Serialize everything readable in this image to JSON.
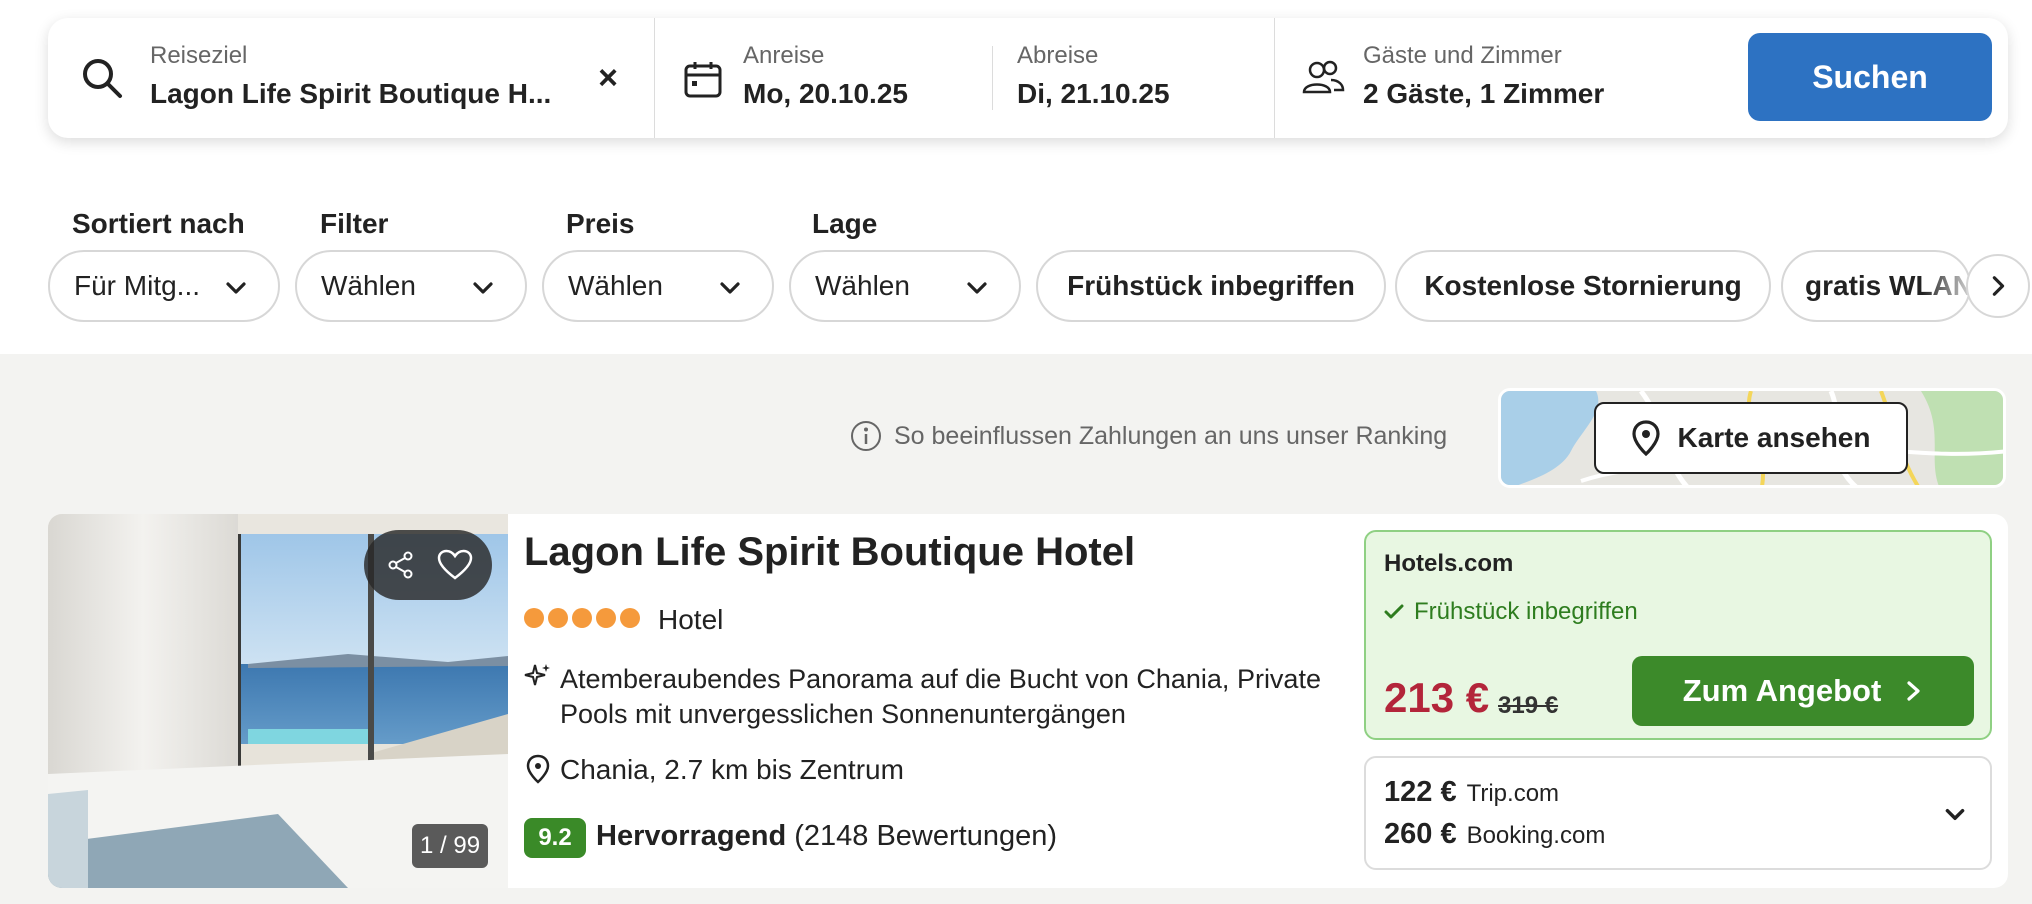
{
  "search": {
    "destination_label": "Reiseziel",
    "destination_value": "Lagon Life Spirit Boutique H...",
    "clear_icon": "×",
    "checkin_label": "Anreise",
    "checkin_value": "Mo, 20.10.25",
    "checkout_label": "Abreise",
    "checkout_value": "Di, 21.10.25",
    "guests_label": "Gäste und Zimmer",
    "guests_value": "2 Gäste, 1 Zimmer",
    "search_button": "Suchen",
    "icons": [
      "search-icon",
      "clear-icon",
      "calendar-icon",
      "guests-icon"
    ]
  },
  "filters": {
    "sort": {
      "label": "Sortiert nach",
      "value": "Für Mitg..."
    },
    "filter": {
      "label": "Filter",
      "value": "Wählen"
    },
    "price": {
      "label": "Preis",
      "value": "Wählen"
    },
    "location": {
      "label": "Lage",
      "value": "Wählen"
    },
    "tags": [
      "Frühstück inbegriffen",
      "Kostenlose Stornierung",
      "gratis WLAN"
    ]
  },
  "info": {
    "ranking_note": "So beeinflussen Zahlungen an uns unser Ranking",
    "map_button": "Karte ansehen"
  },
  "result": {
    "image_counter": "1 / 99",
    "name": "Lagon Life Spirit Boutique Hotel",
    "star_count": 5,
    "type": "Hotel",
    "highlight": "Atemberaubendes Panorama auf die Bucht von Chania, Private Pools mit unvergesslichen Sonnenuntergängen",
    "location": "Chania, 2.7 km bis Zentrum",
    "rating_score": "9.2",
    "rating_word": "Hervorragend",
    "rating_count": "(2148 Bewertungen)",
    "deal": {
      "provider": "Hotels.com",
      "perk": "Frühstück inbegriffen",
      "price": "213 €",
      "old_price": "319 €",
      "button": "Zum Angebot"
    },
    "other_offers": [
      {
        "price": "122 €",
        "site": "Trip.com"
      },
      {
        "price": "260 €",
        "site": "Booking.com"
      }
    ]
  },
  "colors": {
    "search_button": "#2d72c2",
    "deal_button": "#3c8a2a",
    "deal_price": "#b3253a",
    "deal_bg": "#e8f7e2",
    "rating_badge": "#3a8a28",
    "stars": "#f59a3c"
  }
}
